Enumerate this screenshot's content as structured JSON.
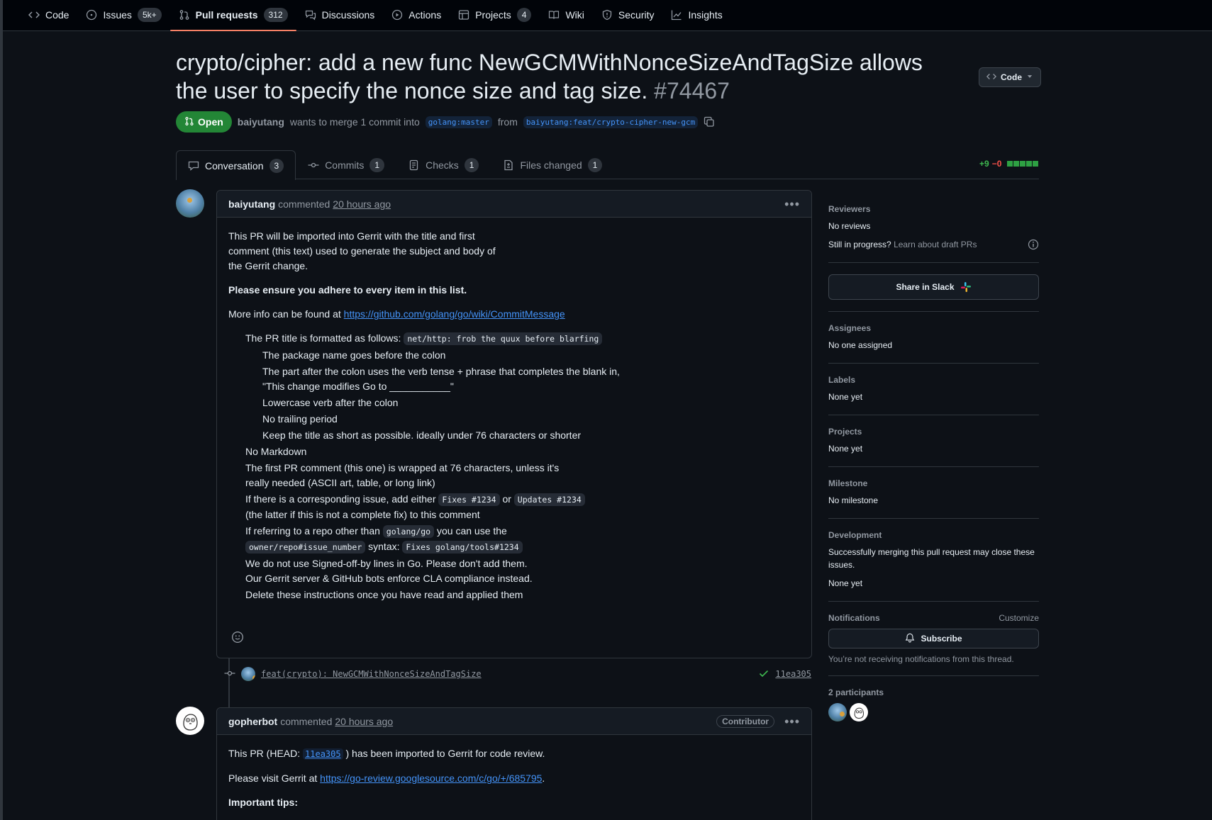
{
  "repo_nav": {
    "items": [
      {
        "label": "Code",
        "icon": "code-icon"
      },
      {
        "label": "Issues",
        "icon": "issue-icon",
        "count": "5k+"
      },
      {
        "label": "Pull requests",
        "icon": "pull-request-icon",
        "count": "312"
      },
      {
        "label": "Discussions",
        "icon": "discussion-icon"
      },
      {
        "label": "Actions",
        "icon": "play-icon"
      },
      {
        "label": "Projects",
        "icon": "table-icon",
        "count": "4"
      },
      {
        "label": "Wiki",
        "icon": "book-icon"
      },
      {
        "label": "Security",
        "icon": "shield-icon"
      },
      {
        "label": "Insights",
        "icon": "graph-icon"
      }
    ],
    "active": "Pull requests"
  },
  "pr": {
    "title": "crypto/cipher: add a new func NewGCMWithNonceSizeAndTagSize allows the user to specify the nonce size and tag size.",
    "number": "#74467",
    "state": "Open",
    "author": "baiyutang",
    "merge_text": "wants to merge 1 commit into",
    "base_branch": "golang:master",
    "from_text": "from",
    "head_branch": "baiyutang:feat/crypto-cipher-new-gcm",
    "code_button": "Code"
  },
  "tabs": [
    {
      "label": "Conversation",
      "count": "3",
      "icon": "comment-icon"
    },
    {
      "label": "Commits",
      "count": "1",
      "icon": "commit-icon"
    },
    {
      "label": "Checks",
      "count": "1",
      "icon": "checklist-icon"
    },
    {
      "label": "Files changed",
      "count": "1",
      "icon": "file-diff-icon"
    }
  ],
  "diffstat": {
    "additions": "+9",
    "deletions": "−0",
    "blocks": 5
  },
  "comment1": {
    "author": "baiyutang",
    "action": "commented",
    "time": "20 hours ago",
    "p1_line1": "This PR will be imported into Gerrit with the title and first",
    "p1_line2": "comment (this text) used to generate the subject and body of",
    "p1_line3": "the Gerrit change.",
    "p2": "Please ensure you adhere to every item in this list.",
    "p3_text": "More info can be found at",
    "p3_link": "https://github.com/golang/go/wiki/CommitMessage",
    "li1_text": "The PR title is formatted as follows:",
    "li1_code": "net/http: frob the quux before blarfing",
    "li1a": "The package name goes before the colon",
    "li1b_line1": "The part after the colon uses the verb tense + phrase that completes the blank in,",
    "li1b_line2": "\"This change modifies Go to ___________\"",
    "li1c": "Lowercase verb after the colon",
    "li1d": "No trailing period",
    "li1e": "Keep the title as short as possible. ideally under 76 characters or shorter",
    "li2": "No Markdown",
    "li3_line1": "The first PR comment (this one) is wrapped at 76 characters, unless it's",
    "li3_line2": "really needed (ASCII art, table, or long link)",
    "li4_pre": "If there is a corresponding issue, add either",
    "li4_code1": "Fixes #1234",
    "li4_or": "or",
    "li4_code2": "Updates #1234",
    "li4_line2": "(the latter if this is not a complete fix) to this comment",
    "li5_pre": "If referring to a repo other than",
    "li5_code1": "golang/go",
    "li5_mid": "you can use the",
    "li5_code2": "owner/repo#issue_number",
    "li5_syntax": "syntax:",
    "li5_code3": "Fixes golang/tools#1234",
    "li6_line1": "We do not use Signed-off-by lines in Go. Please don't add them.",
    "li6_line2": "Our Gerrit server & GitHub bots enforce CLA compliance instead.",
    "li7": "Delete these instructions once you have read and applied them"
  },
  "commit": {
    "message": "feat(crypto): NewGCMWithNonceSizeAndTagSize",
    "sha": "11ea305"
  },
  "comment2": {
    "author": "gopherbot",
    "action": "commented",
    "time": "20 hours ago",
    "role": "Contributor",
    "p1_pre": "This PR (HEAD:",
    "p1_sha": "11ea305",
    "p1_post": ") has been imported to Gerrit for code review.",
    "p2_pre": "Please visit Gerrit at",
    "p2_link": "https://go-review.googlesource.com/c/go/+/685795",
    "p2_post": ".",
    "p3": "Important tips:"
  },
  "sidebar": {
    "reviewers": {
      "heading": "Reviewers",
      "value": "No reviews",
      "draft_q": "Still in progress?",
      "draft_link": "Learn about draft PRs"
    },
    "slack_button": "Share in Slack",
    "assignees": {
      "heading": "Assignees",
      "value": "No one assigned"
    },
    "labels": {
      "heading": "Labels",
      "value": "None yet"
    },
    "projects": {
      "heading": "Projects",
      "value": "None yet"
    },
    "milestone": {
      "heading": "Milestone",
      "value": "No milestone"
    },
    "development": {
      "heading": "Development",
      "desc": "Successfully merging this pull request may close these issues.",
      "value": "None yet"
    },
    "notifications": {
      "heading": "Notifications",
      "customize": "Customize",
      "button": "Subscribe",
      "note": "You’re not receiving notifications from this thread."
    },
    "participants": {
      "heading": "2 participants"
    }
  },
  "colors": {
    "accent": "#4493f8",
    "open_green": "#238636",
    "additions": "#3fb950",
    "deletions": "#f85149",
    "tab_underline": "#f78166"
  }
}
